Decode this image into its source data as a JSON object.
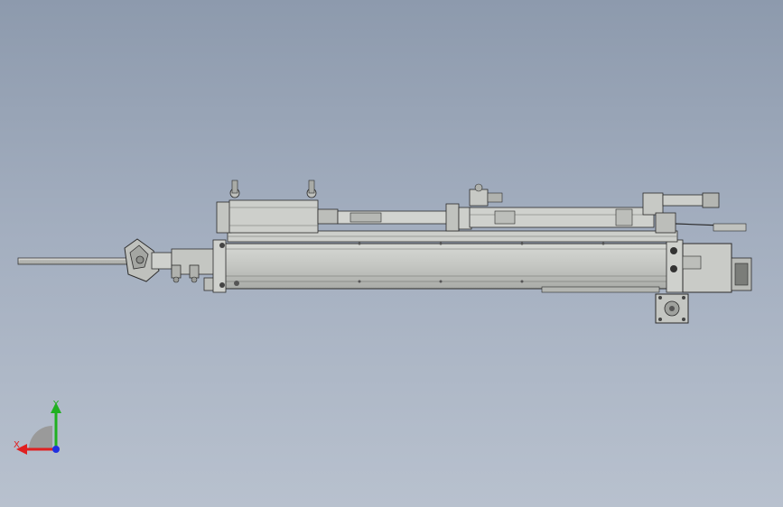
{
  "viewport": {
    "background_top": "#8d9aad",
    "background_bottom": "#b8c1ce",
    "model_fill": "#c9cbc7",
    "model_stroke": "#3a3a3a"
  },
  "triad": {
    "x_label": "X",
    "y_label": "Y",
    "x_color": "#e02020",
    "y_color": "#20b020",
    "z_color": "#2030e0"
  }
}
